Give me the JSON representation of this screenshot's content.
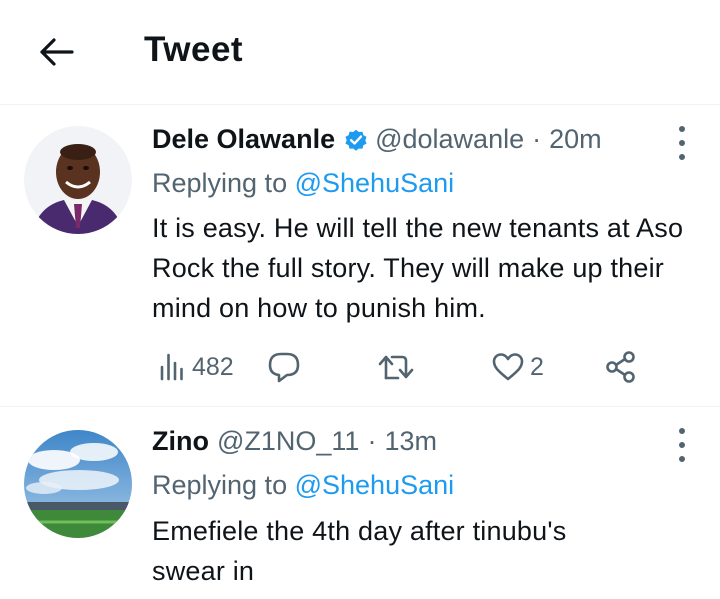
{
  "header": {
    "title": "Tweet",
    "back_icon": "arrow-left-icon"
  },
  "tweets": [
    {
      "author_name": "Dele Olawanle",
      "verified": true,
      "handle": "@dolawanle",
      "separator": "·",
      "time": "20m",
      "replying_prefix": "Replying to",
      "replying_to": "@ShehuSani",
      "text": "It is easy. He will tell the new tenants at Aso Rock the full story. They will make up their mind on how to punish him.",
      "views": "482",
      "likes": "2",
      "icons": [
        "views-icon",
        "reply-icon",
        "retweet-icon",
        "like-icon",
        "share-icon"
      ]
    },
    {
      "author_name": "Zino",
      "handle": "@Z1NO_11",
      "separator": "·",
      "time": "13m",
      "replying_prefix": "Replying to",
      "replying_to": "@ShehuSani",
      "text": "Emefiele the 4th day after tinubu's swear in"
    }
  ],
  "colors": {
    "accent": "#1d9bf0",
    "secondary_text": "#536471",
    "primary_text": "#0f1419",
    "divider": "#eff3f4"
  }
}
